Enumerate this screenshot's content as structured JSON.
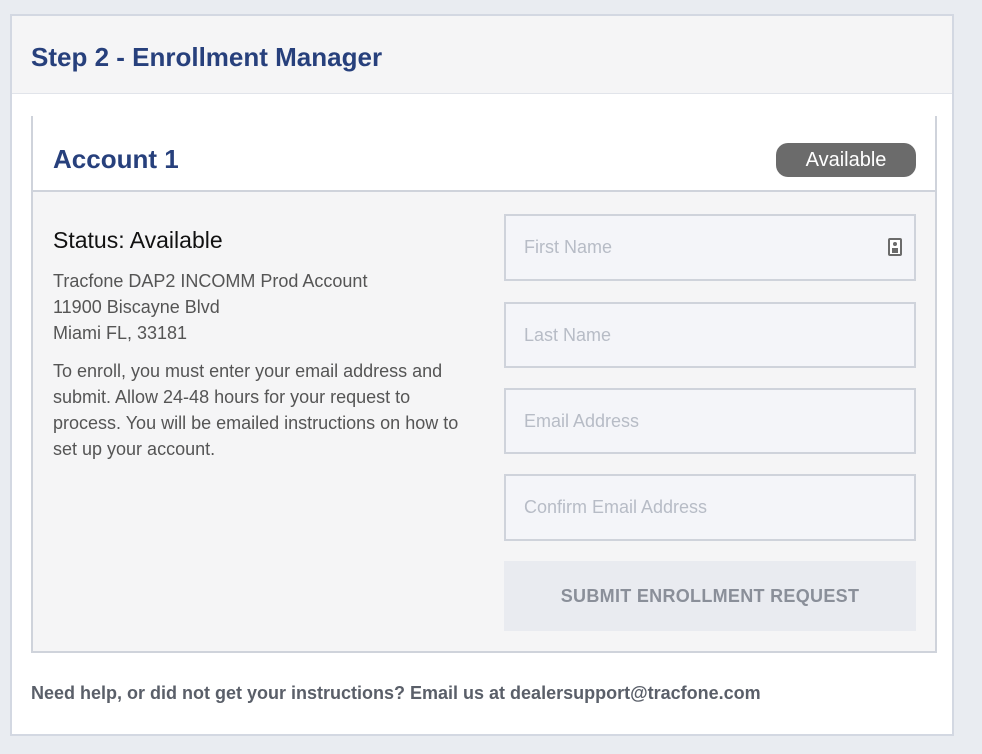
{
  "panel": {
    "title": "Step 2 - Enrollment Manager"
  },
  "account": {
    "title": "Account 1",
    "badge": "Available",
    "status": "Status: Available",
    "address_lines": [
      "Tracfone DAP2 INCOMM Prod Account",
      "11900 Biscayne Blvd",
      "Miami FL, 33181"
    ],
    "instructions": "To enroll, you must enter your email address and submit. Allow 24-48 hours for your request to process. You will be emailed instructions on how to set up your account."
  },
  "form": {
    "first_name": {
      "placeholder": "First Name",
      "value": ""
    },
    "last_name": {
      "placeholder": "Last Name",
      "value": ""
    },
    "email": {
      "placeholder": "Email Address",
      "value": ""
    },
    "confirm_email": {
      "placeholder": "Confirm Email Address",
      "value": ""
    },
    "submit_label": "SUBMIT ENROLLMENT REQUEST"
  },
  "help": {
    "text": "Need help, or did not get your instructions? Email us at dealersupport@tracfone.com"
  },
  "icons": {
    "first_name_field_icon": "contact-card-icon"
  },
  "colors": {
    "heading": "#27407c",
    "badge_bg": "#6b6b6b",
    "page_bg": "#e9ecf1"
  }
}
